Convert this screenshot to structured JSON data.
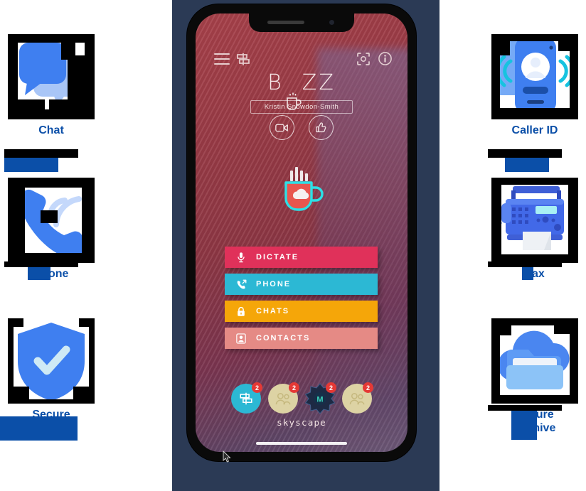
{
  "page": {
    "background": "#ffffff",
    "panel_color": "#2b3a55"
  },
  "features_left": [
    {
      "id": "chat",
      "icon": "chat-bubbles-icon",
      "label": "Chat",
      "label_visible_fragment": "xt",
      "redacted": true,
      "color": "#3f7ff0"
    },
    {
      "id": "phone",
      "icon": "ringing-phone-icon",
      "label": "Phone",
      "label_visible_fragment": "P  e",
      "redacted": true,
      "color": "#3f7ff0"
    },
    {
      "id": "secure",
      "icon": "shield-check-icon",
      "label": "Secure",
      "label_visible_fragment": "e",
      "redacted": true,
      "color": "#3f7ff0"
    }
  ],
  "features_right": [
    {
      "id": "caller-id",
      "icon": "caller-id-phone-icon",
      "label": "Caller ID",
      "label_visible_fragment": "D",
      "redacted": true,
      "color": "#3f7ff0"
    },
    {
      "id": "fax",
      "icon": "fax-machine-icon",
      "label": "Fax",
      "label_visible_fragment": "F x",
      "redacted": true,
      "color": "#0b4fa8"
    },
    {
      "id": "secure-archive",
      "icon": "cloud-folder-icon",
      "label_line1": "Secure",
      "label_line2": "Archive",
      "label_visible_fragment_1": "S    e",
      "label_visible_fragment_2": "A    e",
      "redacted": true,
      "color": "#0b4fa8"
    }
  ],
  "phone": {
    "app_logo": "BUZZ",
    "logo_left": "B",
    "logo_right": "ZZ",
    "user_name": "Kristin Snowdon-Smith",
    "brand": "skyscape",
    "topbar_icons": [
      {
        "name": "hamburger-menu-icon"
      },
      {
        "name": "signpost-icon"
      },
      {
        "name": "scan-qr-icon"
      },
      {
        "name": "info-icon"
      }
    ],
    "circle_buttons": [
      {
        "name": "video-call-button",
        "icon": "video-camera-icon"
      },
      {
        "name": "thumbs-up-button",
        "icon": "thumbs-up-icon"
      }
    ],
    "hero_icon": "coffee-mug-cloud-icon",
    "menu_items": [
      {
        "label": "DICTATE",
        "icon": "microphone-icon",
        "color": "#e0315a"
      },
      {
        "label": "PHONE",
        "icon": "phone-out-icon",
        "color": "#2cb8d4"
      },
      {
        "label": "CHATS",
        "icon": "lock-icon",
        "color": "#f5a609"
      },
      {
        "label": "CONTACTS",
        "icon": "contact-person-icon",
        "color": "#e58a85"
      }
    ],
    "avatars": [
      {
        "name": "avatar-signpost",
        "icon": "signpost-icon",
        "badge": "2",
        "color": "#2cb8d4"
      },
      {
        "name": "avatar-group-1",
        "icon": "two-people-icon",
        "badge": "2",
        "color": "#ddd3a4"
      },
      {
        "name": "avatar-star-m",
        "icon": "star-badge-m-icon",
        "badge": "2",
        "color": "#1d2a44",
        "letter": "M"
      },
      {
        "name": "avatar-group-2",
        "icon": "two-people-icon",
        "badge": "2",
        "color": "#ddd3a4"
      }
    ],
    "badge_color": "#e53935",
    "home_indicator": true
  }
}
